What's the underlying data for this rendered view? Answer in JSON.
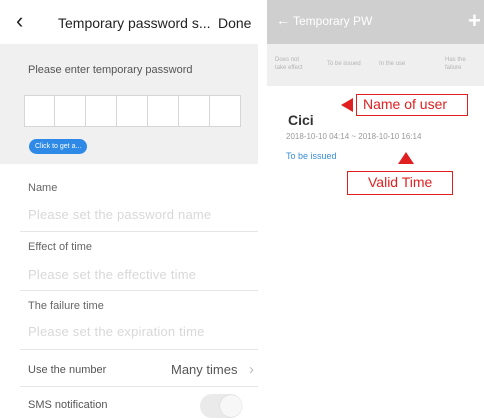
{
  "left_screen": {
    "nav": {
      "back_icon": "chevron-left-icon",
      "title": "Temporary password s...",
      "done_label": "Done"
    },
    "hint": "Please enter temporary password",
    "password_digits": [
      "",
      "",
      "",
      "",
      "",
      "",
      ""
    ],
    "get_button_label": "Click to get a...",
    "fields": [
      {
        "label": "Name",
        "placeholder": "Please set the password name"
      },
      {
        "label": "Effect of time",
        "placeholder": "Please set the effective time"
      },
      {
        "label": "The failure time",
        "placeholder": "Please set the expiration time"
      }
    ],
    "use_number": {
      "label": "Use the number",
      "value": "Many times",
      "chevron_icon": "chevron-right-icon"
    },
    "sms": {
      "label": "SMS notification",
      "enabled": false
    }
  },
  "right_screen": {
    "nav": {
      "back_icon": "arrow-left-icon",
      "title": "Temporary PW",
      "add_icon": "plus-icon"
    },
    "tabs": [
      "Does not take effect",
      "To be issued",
      "In the use",
      "Has the failure"
    ],
    "record": {
      "user": "Cici",
      "valid_time": "2018-10-10 04:14 ~ 2018-10-10 16:14",
      "status": "To be issued"
    },
    "annotations": {
      "name_label": "Name of user",
      "time_label": "Valid Time"
    }
  },
  "colors": {
    "accent_blue": "#2e8ae6",
    "status_blue": "#3a8ed8",
    "annotation_red": "#e02020",
    "right_nav_bg": "#cfcfcf"
  }
}
